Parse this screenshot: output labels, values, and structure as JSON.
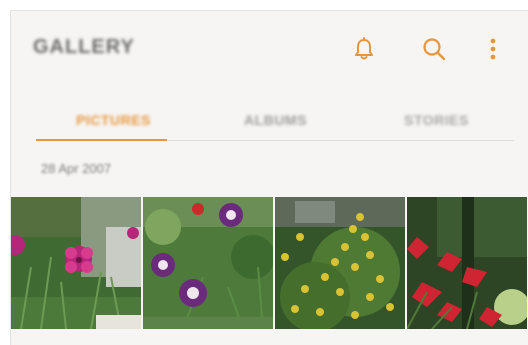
{
  "header": {
    "app_title": "GALLERY",
    "icons": [
      "bell-icon",
      "search-icon",
      "more-vert-icon"
    ],
    "accent_color": "#e8963a"
  },
  "tabs": [
    {
      "label": "PICTURES",
      "active": true
    },
    {
      "label": "ALBUMS",
      "active": false
    },
    {
      "label": "STORIES",
      "active": false
    }
  ],
  "section": {
    "date": "28 Apr 2007"
  },
  "photos": [
    {
      "subject": "pink-dianthus-flowers"
    },
    {
      "subject": "purple-columbine-flowers"
    },
    {
      "subject": "yellow-flowering-shrub"
    },
    {
      "subject": "red-leaves"
    }
  ]
}
